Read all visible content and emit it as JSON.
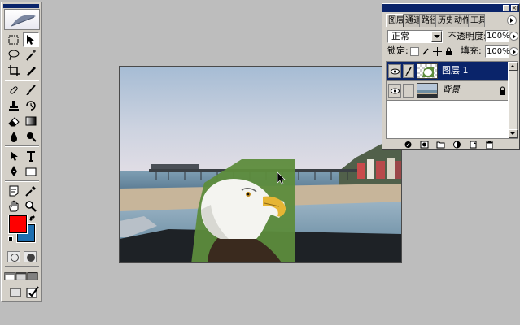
{
  "layers_panel": {
    "tabs": [
      {
        "label": "图层",
        "active": true
      },
      {
        "label": "通道",
        "active": false
      },
      {
        "label": "路径",
        "active": false
      },
      {
        "label": "历史记录",
        "active": false
      },
      {
        "label": "动作",
        "active": false
      },
      {
        "label": "工具预设",
        "active": false
      }
    ],
    "blend_mode": "正常",
    "opacity_label": "不透明度:",
    "opacity_value": "100%",
    "lock_label": "锁定:",
    "fill_label": "填充:",
    "fill_value": "100%",
    "layers": [
      {
        "name": "图层 1",
        "selected": true,
        "visible": true
      },
      {
        "name": "背景",
        "selected": false,
        "visible": true,
        "locked": true
      }
    ]
  },
  "toolbox": {
    "foreground_color": "#ff0000",
    "background_color": "#1e6fb0"
  },
  "document": {
    "scene_colors": {
      "sky_top": "#aabfd6",
      "sky_bottom": "#dcdde6",
      "water": "#6a8fa5",
      "sand": "#c8b89a",
      "selection_fill": "#5f8f3e"
    }
  }
}
